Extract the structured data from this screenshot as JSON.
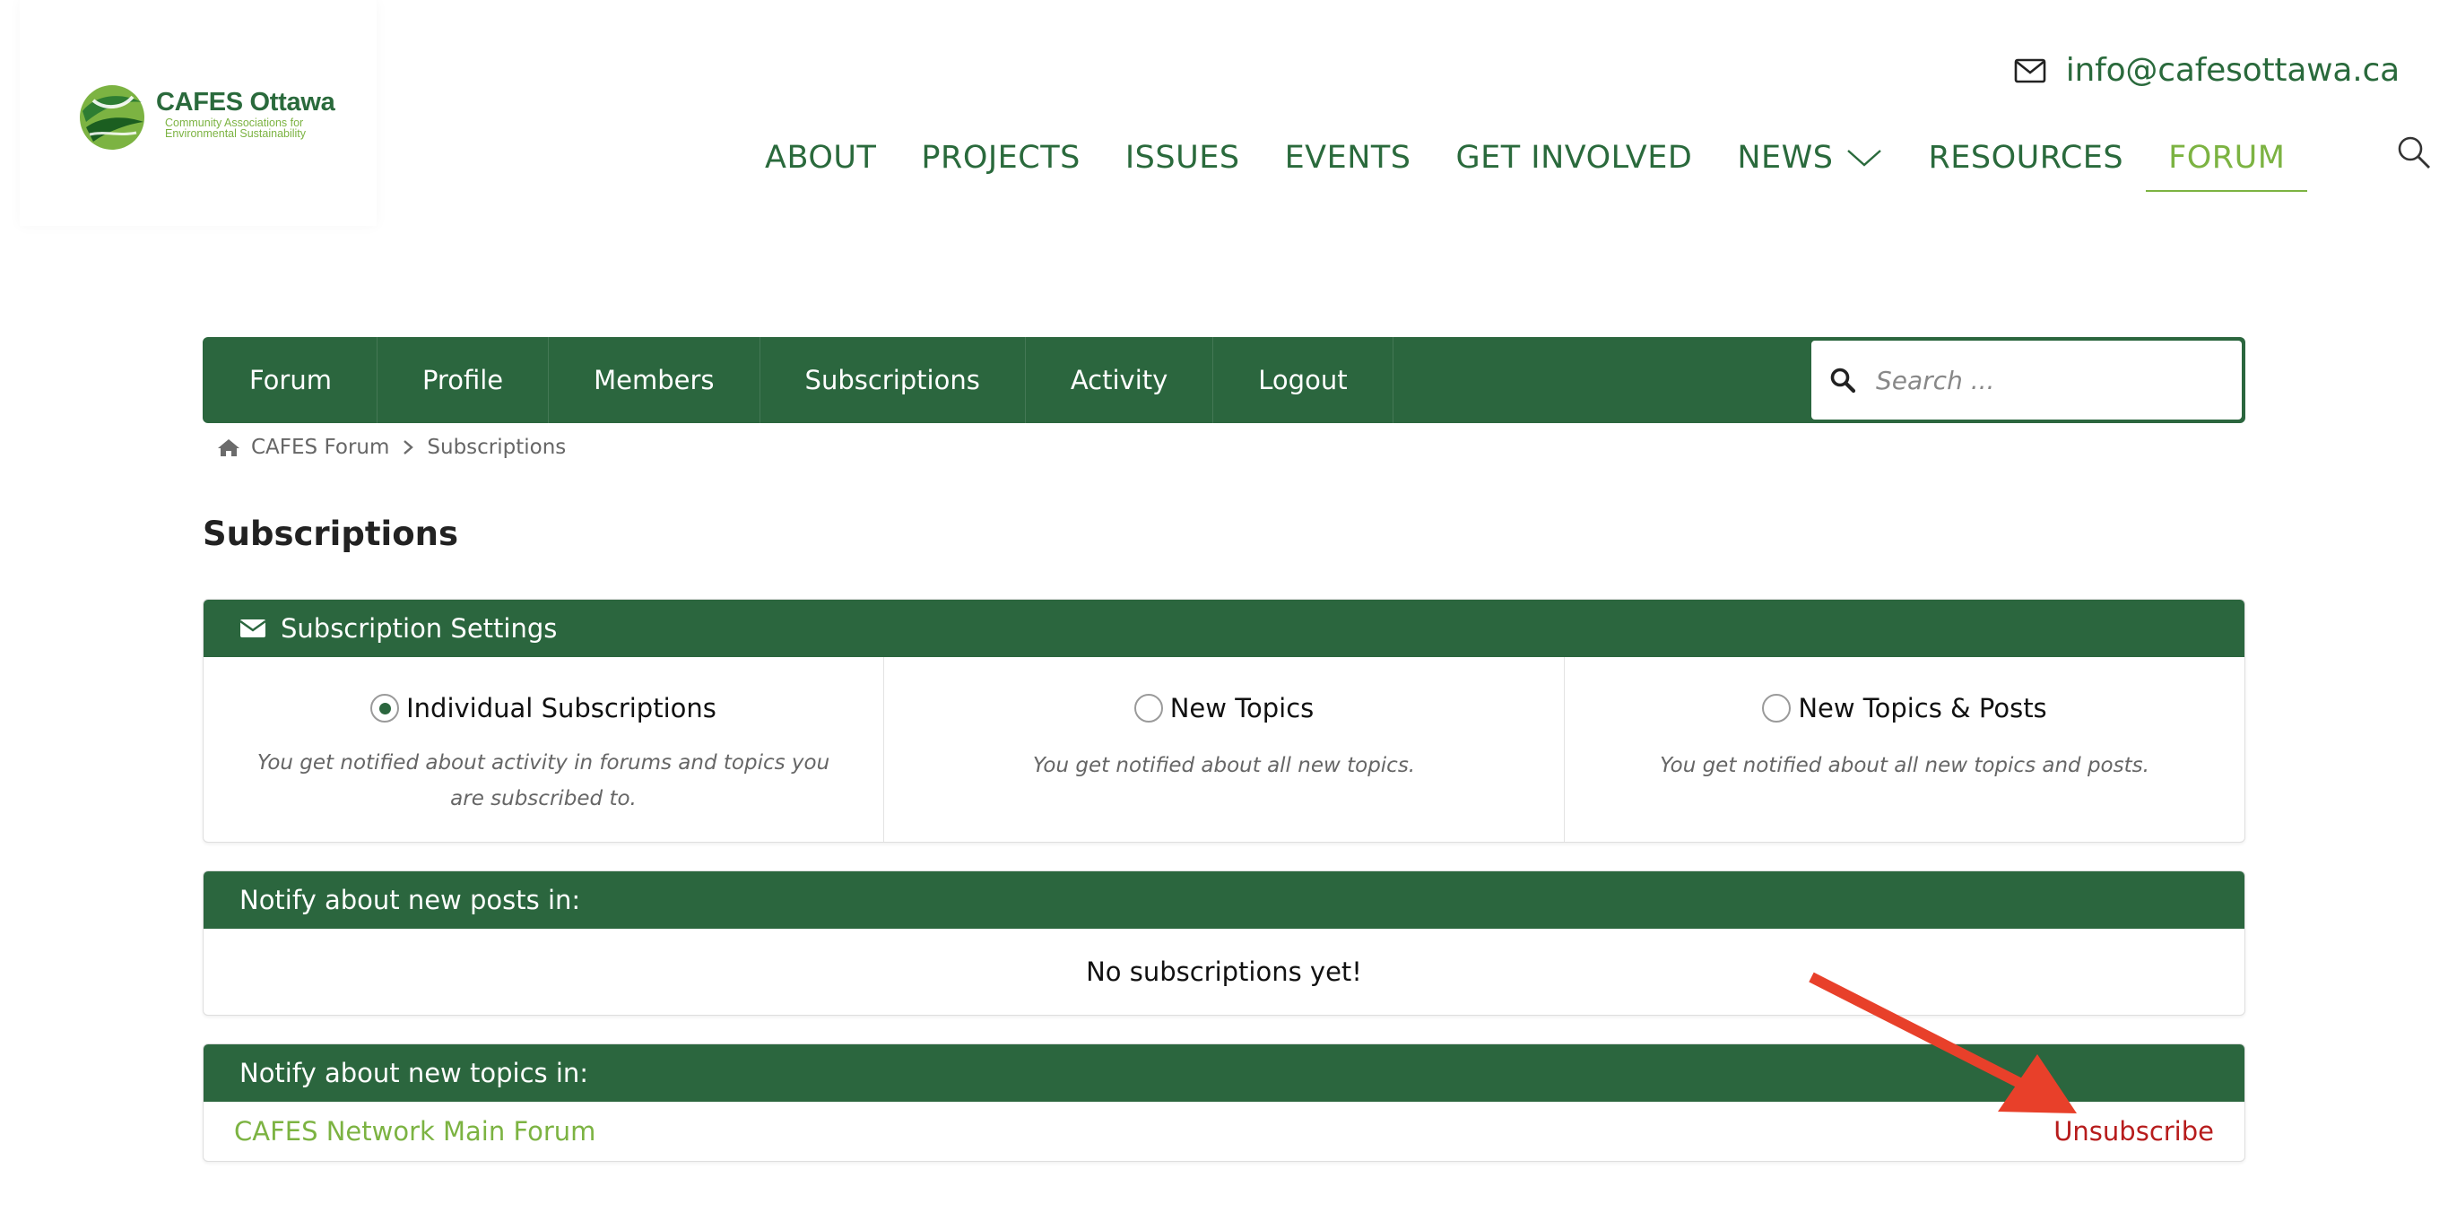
{
  "site": {
    "logo_title": "CAFES Ottawa",
    "logo_subtitle_line1": "Community Associations for",
    "logo_subtitle_line2": "Environmental Sustainability",
    "email": "info@cafesottawa.ca",
    "nav": [
      {
        "label": "ABOUT"
      },
      {
        "label": "PROJECTS"
      },
      {
        "label": "ISSUES"
      },
      {
        "label": "EVENTS"
      },
      {
        "label": "GET INVOLVED"
      },
      {
        "label": "NEWS",
        "has_dropdown": true
      },
      {
        "label": "RESOURCES"
      },
      {
        "label": "FORUM",
        "active": true
      }
    ]
  },
  "forum_bar": {
    "tabs": [
      "Forum",
      "Profile",
      "Members",
      "Subscriptions",
      "Activity",
      "Logout"
    ],
    "search_placeholder": "Search ..."
  },
  "breadcrumb": [
    "CAFES Forum",
    "Subscriptions"
  ],
  "page_title": "Subscriptions",
  "settings": {
    "header": "Subscription Settings",
    "options": [
      {
        "label": "Individual Subscriptions",
        "selected": true,
        "description": "You get notified about activity in forums and topics you are subscribed to."
      },
      {
        "label": "New Topics",
        "selected": false,
        "description": "You get notified about all new topics."
      },
      {
        "label": "New Topics & Posts",
        "selected": false,
        "description": "You get notified about all new topics and posts."
      }
    ]
  },
  "notify_posts": {
    "header": "Notify about new posts in:",
    "empty_text": "No subscriptions yet!"
  },
  "notify_topics": {
    "header": "Notify about new topics in:",
    "forum_name": "CAFES Network Main Forum",
    "unsubscribe_label": "Unsubscribe"
  },
  "colors": {
    "brand_green": "#2b663e",
    "accent_green": "#7cb342",
    "unsubscribe_red": "#b71c1c",
    "annotation_arrow": "#e8402a"
  },
  "icons": [
    "mail-icon",
    "chevron-down-icon",
    "search-icon",
    "home-icon",
    "chevron-right-icon",
    "envelope-icon"
  ]
}
